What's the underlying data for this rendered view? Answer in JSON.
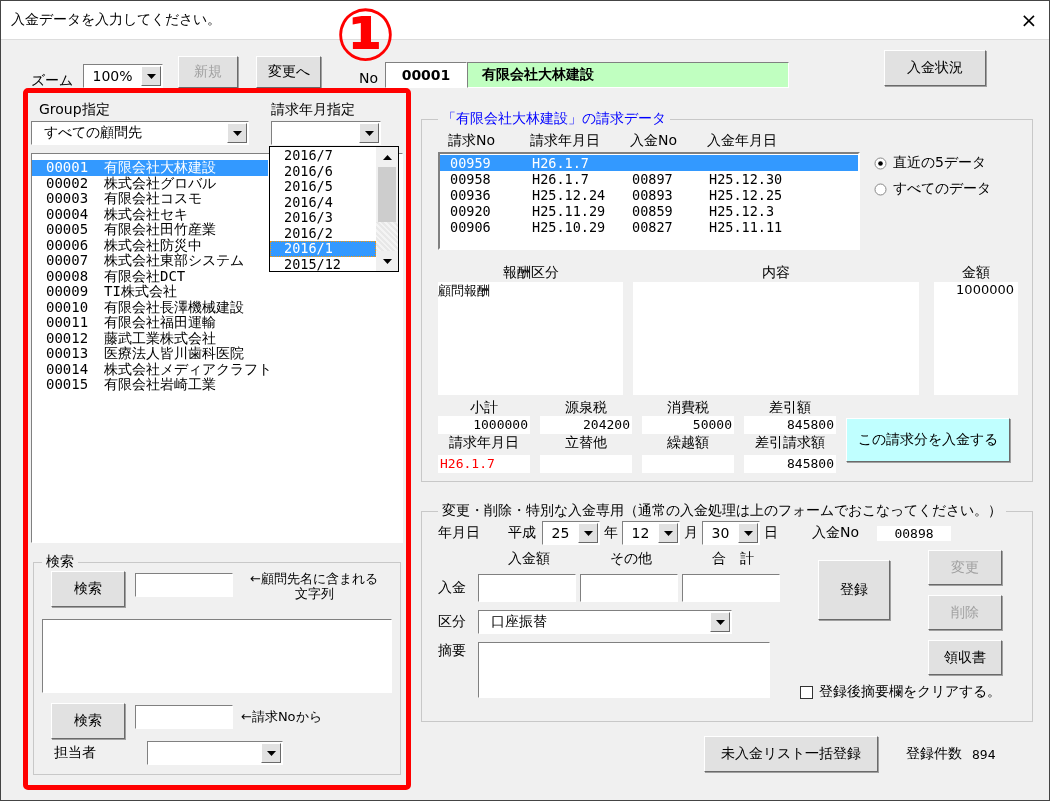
{
  "window": {
    "title": "入金データを入力してください。",
    "close": "×"
  },
  "toolbar": {
    "zoom_label": "ズーム",
    "zoom": "100%",
    "new_button": {
      "label": "新規",
      "disabled": true
    },
    "change_button": {
      "label": "変更へ",
      "disabled": false
    },
    "no_label": "No",
    "client_no": "00001",
    "client_name": "有限会社大林建設",
    "status_button": "入金状況"
  },
  "annotation": {
    "marker": "①"
  },
  "left_panel": {
    "group_label": "Group指定",
    "group_value": "すべての顧問先",
    "month_label": "請求年月指定",
    "month_options": [
      {
        "label": "2016/7",
        "selected": false
      },
      {
        "label": "2016/6",
        "selected": false
      },
      {
        "label": "2016/5",
        "selected": false
      },
      {
        "label": "2016/4",
        "selected": false
      },
      {
        "label": "2016/3",
        "selected": false
      },
      {
        "label": "2016/2",
        "selected": false
      },
      {
        "label": "2016/1",
        "selected": true
      },
      {
        "label": "2015/12",
        "selected": false
      }
    ],
    "clients": [
      {
        "code": "00001",
        "name": "有限会社大林建設",
        "selected": true
      },
      {
        "code": "00002",
        "name": "株式会社グロバル",
        "selected": false
      },
      {
        "code": "00003",
        "name": "有限会社コスモ",
        "selected": false
      },
      {
        "code": "00004",
        "name": "株式会社セキ",
        "selected": false
      },
      {
        "code": "00005",
        "name": "有限会社田竹産業",
        "selected": false
      },
      {
        "code": "00006",
        "name": "株式会社防災中",
        "selected": false
      },
      {
        "code": "00007",
        "name": "株式会社東部システム",
        "selected": false
      },
      {
        "code": "00008",
        "name": "有限会社DCT",
        "selected": false
      },
      {
        "code": "00009",
        "name": "TI株式会社",
        "selected": false
      },
      {
        "code": "00010",
        "name": "有限会社長澤機械建設",
        "selected": false
      },
      {
        "code": "00011",
        "name": "有限会社福田運輸",
        "selected": false
      },
      {
        "code": "00012",
        "name": "藤武工業株式会社",
        "selected": false
      },
      {
        "code": "00013",
        "name": "医療法人皆川歯科医院",
        "selected": false
      },
      {
        "code": "00014",
        "name": "株式会社メディアクラフト",
        "selected": false
      },
      {
        "code": "00015",
        "name": "有限会社岩崎工業",
        "selected": false
      }
    ],
    "search": {
      "title": "検索",
      "button1": "検索",
      "hint1": "←顧問先名に含まれる文字列",
      "button2": "検索",
      "hint2": "←請求Noから",
      "staff_label": "担当者"
    }
  },
  "invoices": {
    "title": "「有限会社大林建設」の請求データ",
    "columns": [
      "請求No",
      "請求年月日",
      "入金No",
      "入金年月日"
    ],
    "rows": [
      {
        "cells": [
          "00959",
          "H26.1.7",
          "",
          ""
        ],
        "selected": true
      },
      {
        "cells": [
          "00958",
          "H26.1.7",
          "00897",
          "H25.12.30"
        ],
        "selected": false
      },
      {
        "cells": [
          "00936",
          "H25.12.24",
          "00893",
          "H25.12.25"
        ],
        "selected": false
      },
      {
        "cells": [
          "00920",
          "H25.11.29",
          "00859",
          "H25.12.3"
        ],
        "selected": false
      },
      {
        "cells": [
          "00906",
          "H25.10.29",
          "00827",
          "H25.11.11"
        ],
        "selected": false
      }
    ],
    "filters": [
      {
        "label": "直近の5データ",
        "selected": true
      },
      {
        "label": "すべてのデータ",
        "selected": false
      }
    ],
    "detail": {
      "headers": [
        "報酬区分",
        "内容",
        "金額"
      ],
      "category": "顧問報酬",
      "amount": "1000000"
    },
    "totals": [
      {
        "label": "小計",
        "value": "1000000",
        "kind": "amount"
      },
      {
        "label": "源泉税",
        "value": "204200",
        "kind": "amount"
      },
      {
        "label": "消費税",
        "value": "50000",
        "kind": "amount"
      },
      {
        "label": "差引額",
        "value": "845800",
        "kind": "amount"
      },
      {
        "label": "請求年月日",
        "value": "H26.1.7",
        "kind": "date"
      },
      {
        "label": "立替他",
        "kind": "amount"
      },
      {
        "label": "繰越額",
        "kind": "amount"
      },
      {
        "label": "差引請求額",
        "value": "845800",
        "kind": "amount"
      }
    ],
    "pay_button": "この請求分を入金する"
  },
  "special": {
    "title": "変更・削除・特別な入金専用（通常の入金処理は上のフォームでおこなってください。）",
    "date_label": "年月日",
    "era": "平成",
    "year": "25",
    "year_unit": "年",
    "month": "12",
    "month_unit": "月",
    "day": "30",
    "day_unit": "日",
    "payment_no_label": "入金No",
    "payment_no": "00898",
    "amount_headers": [
      "入金額",
      "その他",
      "合　計"
    ],
    "amount_label": "入金",
    "category_label": "区分",
    "category": "口座振替",
    "memo_label": "摘要",
    "register_button": "登録",
    "buttons": [
      {
        "label": "変更",
        "disabled": true
      },
      {
        "label": "削除",
        "disabled": true
      },
      {
        "label": "領収書",
        "disabled": false
      }
    ],
    "clear_checkbox": {
      "label": "登録後摘要欄をクリアする。",
      "checked": false
    }
  },
  "footer": {
    "bulk_button": "未入金リスト一括登録",
    "count_label": "登録件数",
    "count": "894"
  }
}
